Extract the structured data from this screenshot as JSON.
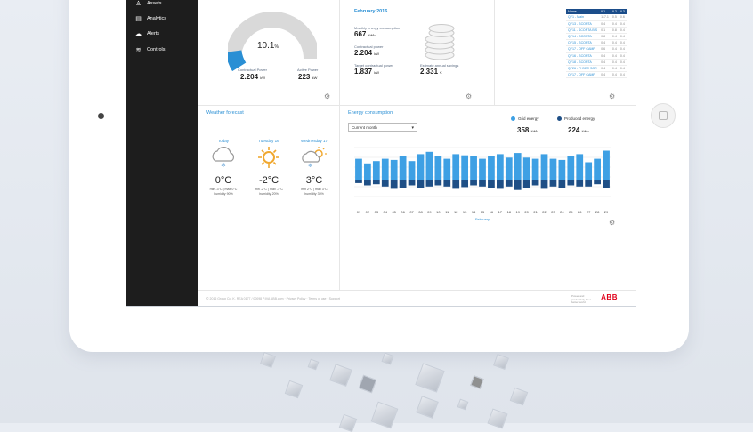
{
  "sidebar": {
    "items": [
      {
        "label": "Assets",
        "icon": "person-icon"
      },
      {
        "label": "Analytics",
        "icon": "chart-icon"
      },
      {
        "label": "Alerts",
        "icon": "alert-icon"
      },
      {
        "label": "Controls",
        "icon": "wifi-icon"
      }
    ]
  },
  "power": {
    "percent": "10.1",
    "percent_unit": "%",
    "fill_fraction": 0.101,
    "contractual_label": "Contractual Power",
    "contractual_value": "2.204",
    "contractual_unit": "kW",
    "active_label": "Active Power",
    "active_value": "223",
    "active_unit": "kW"
  },
  "energy_summary": {
    "month": "February 2016",
    "monthly_label": "Monthly energy consumption",
    "monthly_value": "667",
    "monthly_unit": "kWh",
    "contractual_label": "Contractual power",
    "contractual_value": "2.204",
    "contractual_unit": "kW",
    "target_label": "Target contractual power",
    "target_value": "1.837",
    "target_unit": "kW",
    "savings_label": "Estimate annual savings",
    "savings_value": "2.331",
    "savings_unit": "€"
  },
  "table": {
    "headers": [
      "Name",
      "IL1",
      "IL2",
      "IL3"
    ],
    "rows": [
      [
        "QF1 - Main",
        "117.1",
        "0.5",
        "0.6"
      ],
      [
        "QF13 - SCORTA",
        "0.4",
        "0.4",
        "0.4"
      ],
      [
        "QF11 - SCORTA BIS",
        "0.1",
        "0.8",
        "0.4"
      ],
      [
        "QF14 - SCORTA",
        "0.8",
        "0.4",
        "0.4"
      ],
      [
        "QF15 - SCORTA",
        "0.4",
        "0.4",
        "0.4"
      ],
      [
        "QF17 - OFF CAMP",
        "0.6",
        "0.4",
        "0.4"
      ],
      [
        "QF16 - SCORTA",
        "0.4",
        "0.4",
        "0.4"
      ],
      [
        "QF18 - SCORTA",
        "0.4",
        "0.4",
        "0.4"
      ],
      [
        "QF26 - FI DEC SGR",
        "0.4",
        "0.4",
        "0.4"
      ],
      [
        "QF17 - OFF CAMP",
        "0.4",
        "0.4",
        "0.4"
      ]
    ]
  },
  "weather": {
    "title": "Weather forecast",
    "days": [
      {
        "day": "Today",
        "temp": "0°C",
        "minmax": "min -3°C  |  max 0°C",
        "humidity": "humidity 90%",
        "icon": "snow-cloud-icon"
      },
      {
        "day": "Tuesday 16",
        "temp": "-2°C",
        "minmax": "min -2°C  |  max -1°C",
        "humidity": "humidity 20%",
        "icon": "sun-icon"
      },
      {
        "day": "Wednesday 17",
        "temp": "3°C",
        "minmax": "min 2°C  |  max 3°C",
        "humidity": "humidity 35%",
        "icon": "sun-snow-cloud-icon"
      }
    ]
  },
  "energy": {
    "title": "Energy consumption",
    "select_value": "Current month",
    "grid_label": "Grid energy",
    "grid_value": "358",
    "grid_unit": "kWh",
    "produced_label": "Produced energy",
    "produced_value": "224",
    "produced_unit": "kWh",
    "x_label": "February",
    "colors": {
      "grid": "#3ea0e4",
      "produced": "#1e4f86"
    }
  },
  "chart_data": {
    "type": "bar",
    "title": "",
    "xlabel": "February",
    "categories": [
      "01",
      "02",
      "03",
      "04",
      "05",
      "06",
      "07",
      "08",
      "09",
      "10",
      "11",
      "12",
      "13",
      "14",
      "15",
      "16",
      "17",
      "18",
      "19",
      "20",
      "21",
      "22",
      "23",
      "24",
      "25",
      "26",
      "27",
      "28",
      "29"
    ],
    "series": [
      {
        "name": "Grid energy",
        "values": [
          18,
          14,
          16,
          18,
          17,
          20,
          16,
          22,
          24,
          20,
          18,
          22,
          21,
          20,
          18,
          20,
          22,
          19,
          23,
          19,
          18,
          22,
          18,
          17,
          20,
          22,
          15,
          18,
          25
        ]
      },
      {
        "name": "Produced energy",
        "values": [
          -6,
          -10,
          -8,
          -12,
          -16,
          -14,
          -10,
          -14,
          -12,
          -10,
          -12,
          -16,
          -13,
          -10,
          -12,
          -14,
          -16,
          -12,
          -18,
          -14,
          -10,
          -16,
          -12,
          -14,
          -10,
          -12,
          -12,
          -8,
          -14
        ]
      }
    ]
  },
  "footer": {
    "text": "© 2016 Group Co. K. REA 0177 / 00098 P.IVA   ABB.com   ·   Privacy Policy   ·   Terms of use   ·   Support",
    "tagline": "Power and productivity for a better world",
    "brand": "ABB"
  }
}
